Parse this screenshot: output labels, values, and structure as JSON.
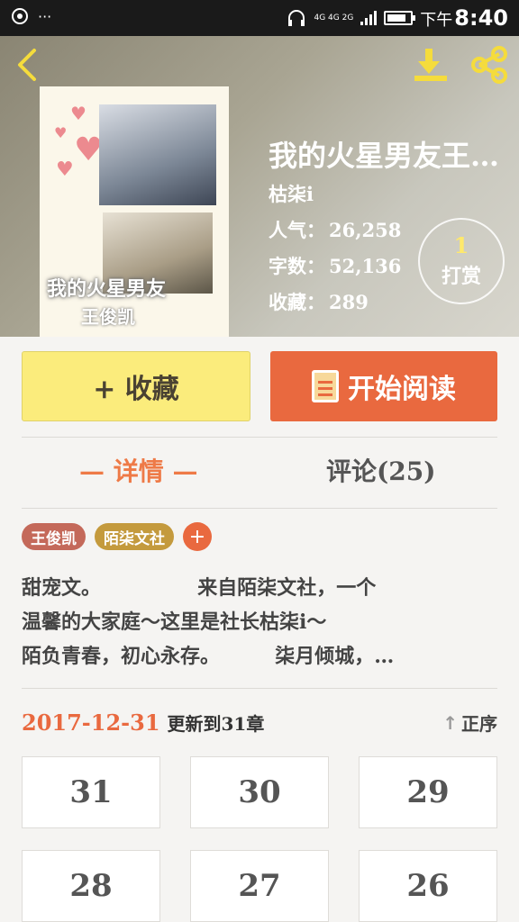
{
  "status_bar": {
    "left_dots": "···",
    "network": "4G 4G 2G",
    "time_prefix": "下午",
    "time": "8:40",
    "battery_level": 0.85
  },
  "book": {
    "title": "我的火星男友王…",
    "author": "枯柒i",
    "stats": [
      {
        "label": "人气：",
        "value": "26,258"
      },
      {
        "label": "字数：",
        "value": "52,136"
      },
      {
        "label": "收藏：",
        "value": "289"
      }
    ],
    "tip": {
      "count": "1",
      "label": "打赏"
    },
    "cover": {
      "title_line1": "我的火星男友",
      "title_line2": "王俊凯"
    }
  },
  "actions": {
    "favorite_label": "+ 收藏",
    "read_label": "开始阅读"
  },
  "tabs": {
    "detail": "— 详情 —",
    "comments": "评论(25)"
  },
  "tags": [
    {
      "label": "王俊凯",
      "color": "#c4695a"
    },
    {
      "label": "陌柒文社",
      "color": "#c49a3d"
    }
  ],
  "description": [
    "甜宠文。              来自陌柒文社，一个",
    "温馨的大家庭～这里是社长枯柒i～",
    "陌负青春，初心永存。        柒月倾城，…"
  ],
  "update": {
    "date": "2017-12-31",
    "text": "更新到31章",
    "order_label": "正序"
  },
  "chapters": [
    "31",
    "30",
    "29",
    "28",
    "27",
    "26"
  ],
  "colors": {
    "accent": "#e9693f",
    "favorite": "#fbec7c"
  }
}
